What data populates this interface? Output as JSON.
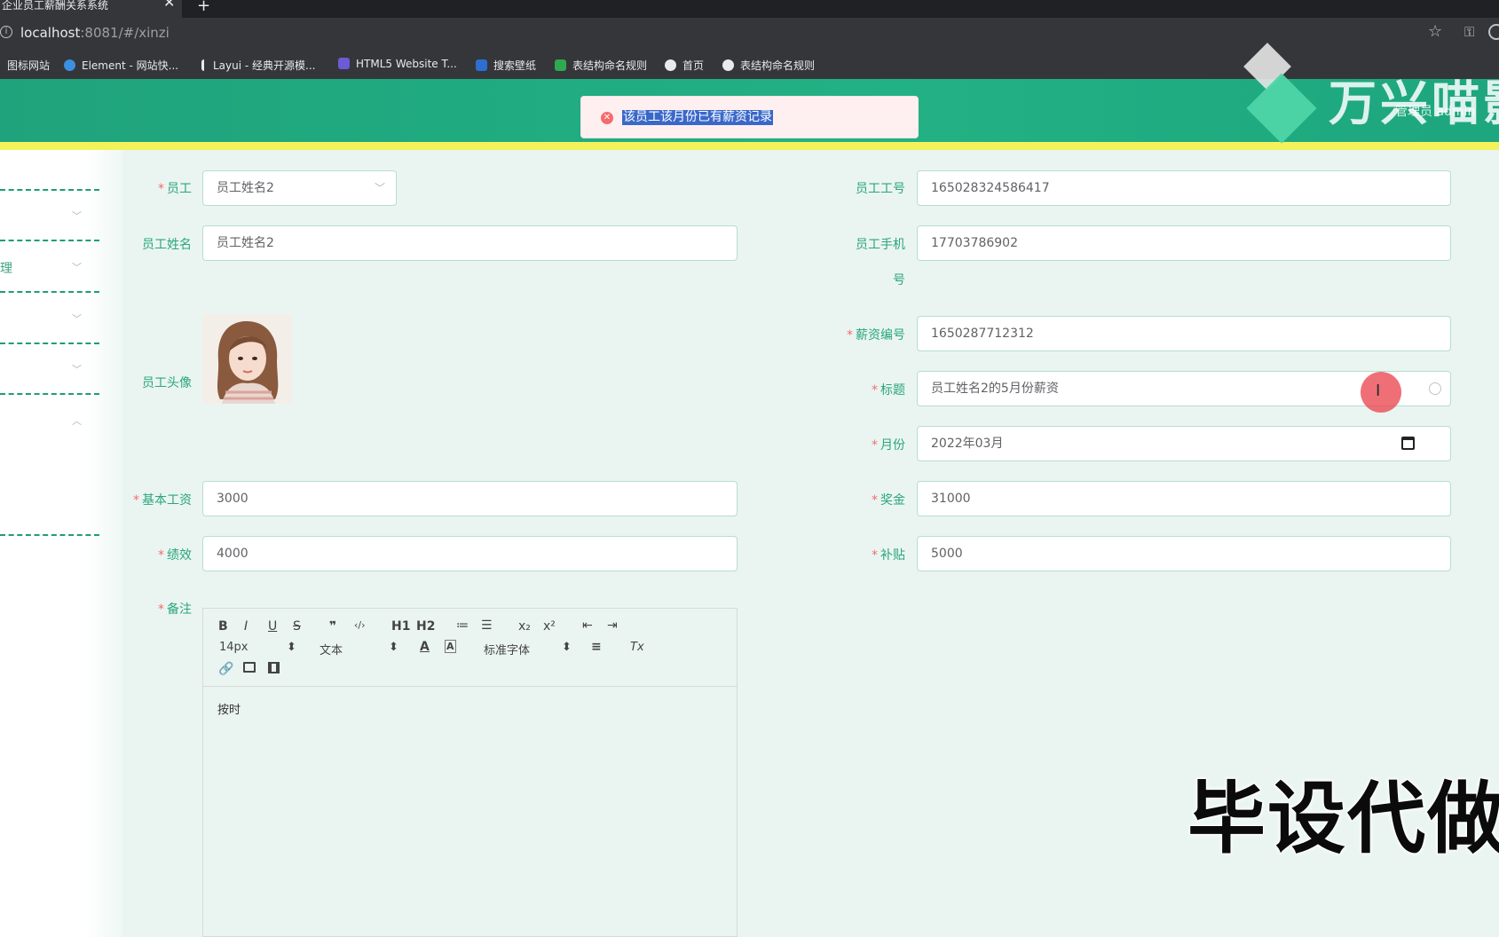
{
  "browser": {
    "tab_title": "企业员工薪酬关系系统",
    "tab_close": "✕",
    "new_tab": "+",
    "url_host": "localhost",
    "url_rest": ":8081/#/xinzi",
    "bookmarks": [
      "图标网站",
      "Element - 网站快...",
      "Layui - 经典开源模...",
      "HTML5 Website T...",
      "搜索壁纸",
      "表结构命名规则",
      "首页",
      "表结构命名规则"
    ]
  },
  "header": {
    "admin_label": "管理员 admin"
  },
  "watermark": {
    "brand": "万兴喵影",
    "promo": "毕设代做"
  },
  "message": {
    "type": "error",
    "text": "该员工该月份已有薪资记录",
    "icon": "error-circle-icon"
  },
  "sidebar": {
    "partial_label": "理"
  },
  "form": {
    "employee": {
      "label": "员工",
      "value": "员工姓名2"
    },
    "employee_no": {
      "label": "员工工号",
      "value": "165028324586417"
    },
    "employee_name": {
      "label": "员工姓名",
      "value": "员工姓名2"
    },
    "phone": {
      "label_line1": "员工手机",
      "label_line2": "号",
      "value": "17703786902"
    },
    "avatar": {
      "label": "员工头像"
    },
    "salary_no": {
      "label": "薪资编号",
      "value": "1650287712312"
    },
    "title": {
      "label": "标题",
      "value": "员工姓名2的5月份薪资"
    },
    "month": {
      "label": "月份",
      "value": "2022年03月"
    },
    "base_salary": {
      "label": "基本工资",
      "value": "3000"
    },
    "bonus": {
      "label": "奖金",
      "value": "31000"
    },
    "performance": {
      "label": "绩效",
      "value": "4000"
    },
    "allowance": {
      "label": "补贴",
      "value": "5000"
    },
    "remark": {
      "label": "备注",
      "content": "按时",
      "toolbar": {
        "bold": "B",
        "italic": "I",
        "underline": "U",
        "strike": "S",
        "quote": "❞",
        "code": "‹/›",
        "h1": "H1",
        "h2": "H2",
        "ordered_list": "≔",
        "bullet_list": "☰",
        "sub": "x₂",
        "sup": "x²",
        "outdent": "⇤",
        "indent": "⇥",
        "size": "14px",
        "block": "文本",
        "font": "标准字体",
        "color": "A",
        "bgcolor": "A",
        "align": "≡",
        "clean": "Tx"
      }
    }
  },
  "colors": {
    "brand": "#22b184",
    "accent_line": "#f3f25a",
    "label": "#2aa57d",
    "error": "#f56c6c"
  }
}
